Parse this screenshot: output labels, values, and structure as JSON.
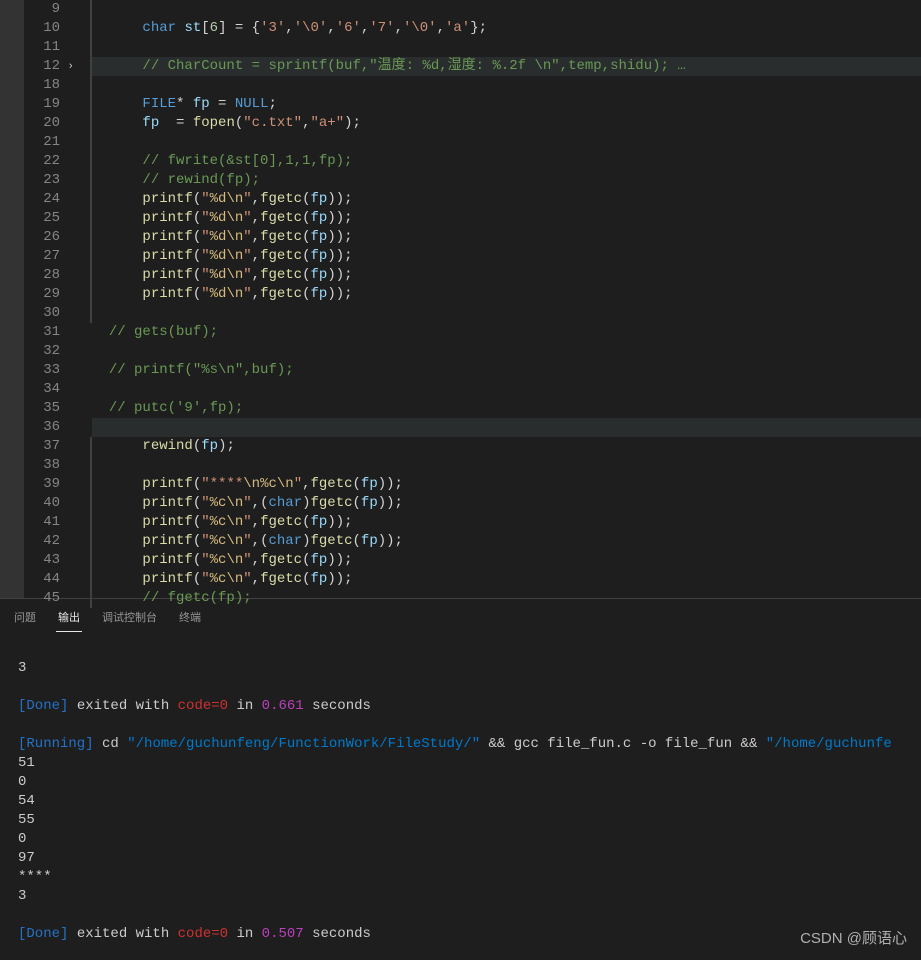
{
  "lines": [
    {
      "n": 9,
      "indent": 3,
      "bar": true,
      "tokens": []
    },
    {
      "n": 10,
      "indent": 3,
      "bar": true,
      "tokens": [
        [
          "type",
          "char"
        ],
        [
          "punct",
          " "
        ],
        [
          "var",
          "st"
        ],
        [
          "punct",
          "["
        ],
        [
          "num",
          "6"
        ],
        [
          "punct",
          "] = {"
        ],
        [
          "str",
          "'3'"
        ],
        [
          "punct",
          ","
        ],
        [
          "str",
          "'\\0'"
        ],
        [
          "punct",
          ","
        ],
        [
          "str",
          "'6'"
        ],
        [
          "punct",
          ","
        ],
        [
          "str",
          "'7'"
        ],
        [
          "punct",
          ","
        ],
        [
          "str",
          "'\\0'"
        ],
        [
          "punct",
          ","
        ],
        [
          "str",
          "'a'"
        ],
        [
          "punct",
          "};"
        ]
      ]
    },
    {
      "n": 11,
      "indent": 3,
      "bar": true,
      "tokens": []
    },
    {
      "n": 12,
      "indent": 3,
      "bar": true,
      "hl": true,
      "chevron": true,
      "tokens": [
        [
          "cmt",
          "// CharCount = sprintf(buf,\"温度: %d,湿度: %.2f \\n\",temp,shidu); …"
        ]
      ]
    },
    {
      "n": 18,
      "indent": 3,
      "bar": true,
      "tokens": []
    },
    {
      "n": 19,
      "indent": 3,
      "bar": true,
      "tokens": [
        [
          "type",
          "FILE"
        ],
        [
          "punct",
          "* "
        ],
        [
          "var",
          "fp"
        ],
        [
          "punct",
          " = "
        ],
        [
          "const",
          "NULL"
        ],
        [
          "punct",
          ";"
        ]
      ]
    },
    {
      "n": 20,
      "indent": 3,
      "bar": true,
      "tokens": [
        [
          "var",
          "fp"
        ],
        [
          "punct",
          "  = "
        ],
        [
          "fn",
          "fopen"
        ],
        [
          "punct",
          "("
        ],
        [
          "str",
          "\"c.txt\""
        ],
        [
          "punct",
          ","
        ],
        [
          "str",
          "\"a+\""
        ],
        [
          "punct",
          ");"
        ]
      ]
    },
    {
      "n": 21,
      "indent": 3,
      "bar": true,
      "tokens": []
    },
    {
      "n": 22,
      "indent": 3,
      "bar": true,
      "tokens": [
        [
          "cmt",
          "// fwrite(&st[0],1,1,fp);"
        ]
      ]
    },
    {
      "n": 23,
      "indent": 3,
      "bar": true,
      "tokens": [
        [
          "cmt",
          "// rewind(fp);"
        ]
      ]
    },
    {
      "n": 24,
      "indent": 3,
      "bar": true,
      "tokens": [
        [
          "fn",
          "printf"
        ],
        [
          "punct",
          "("
        ],
        [
          "str",
          "\""
        ],
        [
          "esc",
          "%d\\n"
        ],
        [
          "str",
          "\""
        ],
        [
          "punct",
          ","
        ],
        [
          "fn",
          "fgetc"
        ],
        [
          "punct",
          "("
        ],
        [
          "var",
          "fp"
        ],
        [
          "punct",
          "));"
        ]
      ]
    },
    {
      "n": 25,
      "indent": 3,
      "bar": true,
      "tokens": [
        [
          "fn",
          "printf"
        ],
        [
          "punct",
          "("
        ],
        [
          "str",
          "\""
        ],
        [
          "esc",
          "%d\\n"
        ],
        [
          "str",
          "\""
        ],
        [
          "punct",
          ","
        ],
        [
          "fn",
          "fgetc"
        ],
        [
          "punct",
          "("
        ],
        [
          "var",
          "fp"
        ],
        [
          "punct",
          "));"
        ]
      ]
    },
    {
      "n": 26,
      "indent": 3,
      "bar": true,
      "tokens": [
        [
          "fn",
          "printf"
        ],
        [
          "punct",
          "("
        ],
        [
          "str",
          "\""
        ],
        [
          "esc",
          "%d\\n"
        ],
        [
          "str",
          "\""
        ],
        [
          "punct",
          ","
        ],
        [
          "fn",
          "fgetc"
        ],
        [
          "punct",
          "("
        ],
        [
          "var",
          "fp"
        ],
        [
          "punct",
          "));"
        ]
      ]
    },
    {
      "n": 27,
      "indent": 3,
      "bar": true,
      "tokens": [
        [
          "fn",
          "printf"
        ],
        [
          "punct",
          "("
        ],
        [
          "str",
          "\""
        ],
        [
          "esc",
          "%d\\n"
        ],
        [
          "str",
          "\""
        ],
        [
          "punct",
          ","
        ],
        [
          "fn",
          "fgetc"
        ],
        [
          "punct",
          "("
        ],
        [
          "var",
          "fp"
        ],
        [
          "punct",
          "));"
        ]
      ]
    },
    {
      "n": 28,
      "indent": 3,
      "bar": true,
      "tokens": [
        [
          "fn",
          "printf"
        ],
        [
          "punct",
          "("
        ],
        [
          "str",
          "\""
        ],
        [
          "esc",
          "%d\\n"
        ],
        [
          "str",
          "\""
        ],
        [
          "punct",
          ","
        ],
        [
          "fn",
          "fgetc"
        ],
        [
          "punct",
          "("
        ],
        [
          "var",
          "fp"
        ],
        [
          "punct",
          "));"
        ]
      ]
    },
    {
      "n": 29,
      "indent": 3,
      "bar": true,
      "tokens": [
        [
          "fn",
          "printf"
        ],
        [
          "punct",
          "("
        ],
        [
          "str",
          "\""
        ],
        [
          "esc",
          "%d\\n"
        ],
        [
          "str",
          "\""
        ],
        [
          "punct",
          ","
        ],
        [
          "fn",
          "fgetc"
        ],
        [
          "punct",
          "("
        ],
        [
          "var",
          "fp"
        ],
        [
          "punct",
          "));"
        ]
      ]
    },
    {
      "n": 30,
      "indent": 3,
      "bar": true,
      "tokens": []
    },
    {
      "n": 31,
      "indent": 1,
      "bar": false,
      "tokens": [
        [
          "cmt",
          "// gets(buf);"
        ]
      ]
    },
    {
      "n": 32,
      "indent": 1,
      "bar": false,
      "tokens": []
    },
    {
      "n": 33,
      "indent": 1,
      "bar": false,
      "tokens": [
        [
          "cmt",
          "// printf(\"%s\\n\",buf);"
        ]
      ]
    },
    {
      "n": 34,
      "indent": 1,
      "bar": false,
      "tokens": []
    },
    {
      "n": 35,
      "indent": 1,
      "bar": false,
      "tokens": [
        [
          "cmt",
          "// putc('9',fp);"
        ]
      ]
    },
    {
      "n": 36,
      "indent": 1,
      "bar": false,
      "hl": true,
      "tokens": []
    },
    {
      "n": 37,
      "indent": 3,
      "bar": true,
      "tokens": [
        [
          "fn",
          "rewind"
        ],
        [
          "punct",
          "("
        ],
        [
          "var",
          "fp"
        ],
        [
          "punct",
          ");"
        ]
      ]
    },
    {
      "n": 38,
      "indent": 3,
      "bar": true,
      "tokens": []
    },
    {
      "n": 39,
      "indent": 3,
      "bar": true,
      "tokens": [
        [
          "fn",
          "printf"
        ],
        [
          "punct",
          "("
        ],
        [
          "str",
          "\"****"
        ],
        [
          "esc",
          "\\n%c\\n"
        ],
        [
          "str",
          "\""
        ],
        [
          "punct",
          ","
        ],
        [
          "fn",
          "fgetc"
        ],
        [
          "punct",
          "("
        ],
        [
          "var",
          "fp"
        ],
        [
          "punct",
          "));"
        ]
      ]
    },
    {
      "n": 40,
      "indent": 3,
      "bar": true,
      "tokens": [
        [
          "fn",
          "printf"
        ],
        [
          "punct",
          "("
        ],
        [
          "str",
          "\""
        ],
        [
          "esc",
          "%c\\n"
        ],
        [
          "str",
          "\""
        ],
        [
          "punct",
          ",("
        ],
        [
          "type",
          "char"
        ],
        [
          "punct",
          ")"
        ],
        [
          "fn",
          "fgetc"
        ],
        [
          "punct",
          "("
        ],
        [
          "var",
          "fp"
        ],
        [
          "punct",
          "));"
        ]
      ]
    },
    {
      "n": 41,
      "indent": 3,
      "bar": true,
      "tokens": [
        [
          "fn",
          "printf"
        ],
        [
          "punct",
          "("
        ],
        [
          "str",
          "\""
        ],
        [
          "esc",
          "%c\\n"
        ],
        [
          "str",
          "\""
        ],
        [
          "punct",
          ","
        ],
        [
          "fn",
          "fgetc"
        ],
        [
          "punct",
          "("
        ],
        [
          "var",
          "fp"
        ],
        [
          "punct",
          "));"
        ]
      ]
    },
    {
      "n": 42,
      "indent": 3,
      "bar": true,
      "tokens": [
        [
          "fn",
          "printf"
        ],
        [
          "punct",
          "("
        ],
        [
          "str",
          "\""
        ],
        [
          "esc",
          "%c\\n"
        ],
        [
          "str",
          "\""
        ],
        [
          "punct",
          ",("
        ],
        [
          "type",
          "char"
        ],
        [
          "punct",
          ")"
        ],
        [
          "fn",
          "fgetc"
        ],
        [
          "punct",
          "("
        ],
        [
          "var",
          "fp"
        ],
        [
          "punct",
          "));"
        ]
      ]
    },
    {
      "n": 43,
      "indent": 3,
      "bar": true,
      "tokens": [
        [
          "fn",
          "printf"
        ],
        [
          "punct",
          "("
        ],
        [
          "str",
          "\""
        ],
        [
          "esc",
          "%c\\n"
        ],
        [
          "str",
          "\""
        ],
        [
          "punct",
          ","
        ],
        [
          "fn",
          "fgetc"
        ],
        [
          "punct",
          "("
        ],
        [
          "var",
          "fp"
        ],
        [
          "punct",
          "));"
        ]
      ]
    },
    {
      "n": 44,
      "indent": 3,
      "bar": true,
      "tokens": [
        [
          "fn",
          "printf"
        ],
        [
          "punct",
          "("
        ],
        [
          "str",
          "\""
        ],
        [
          "esc",
          "%c\\n"
        ],
        [
          "str",
          "\""
        ],
        [
          "punct",
          ","
        ],
        [
          "fn",
          "fgetc"
        ],
        [
          "punct",
          "("
        ],
        [
          "var",
          "fp"
        ],
        [
          "punct",
          "));"
        ]
      ]
    },
    {
      "n": 45,
      "indent": 3,
      "bar": true,
      "tokens": [
        [
          "cmt",
          "// fgetc(fp);"
        ]
      ]
    }
  ],
  "tabs": {
    "items": [
      "问题",
      "输出",
      "调试控制台",
      "终端"
    ],
    "activeIndex": 1
  },
  "output": {
    "pre": "3",
    "done1": {
      "label": "[Done]",
      "text": " exited with ",
      "codeLabel": "code=0",
      "text2": " in ",
      "time": "0.661",
      "text3": " seconds"
    },
    "running": {
      "label": "[Running]",
      "cmd": " cd ",
      "path": "\"/home/guchunfeng/FunctionWork/FileStudy/\"",
      "rest": " && gcc file_fun.c -o file_fun && ",
      "path2": "\"/home/guchunfe"
    },
    "vals": [
      "51",
      "0",
      "54",
      "55",
      "0",
      "97",
      "****",
      "3"
    ],
    "done2": {
      "label": "[Done]",
      "text": " exited with ",
      "codeLabel": "code=0",
      "text2": " in ",
      "time": "0.507",
      "text3": " seconds"
    }
  },
  "watermark": "CSDN @顾语心"
}
